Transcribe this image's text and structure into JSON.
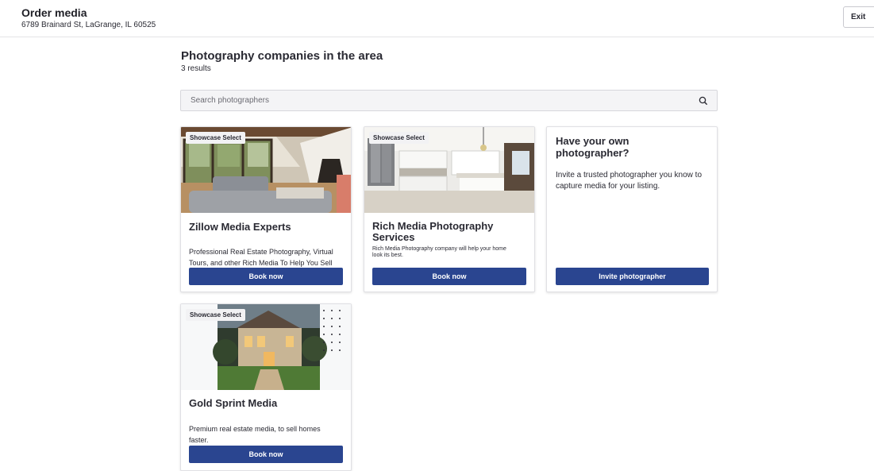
{
  "header": {
    "title": "Order media",
    "address": "6789 Brainard St, LaGrange, IL 60525",
    "exit_label": "Exit"
  },
  "main": {
    "title": "Photography companies in the area",
    "results": "3 results",
    "search_placeholder": "Search photographers"
  },
  "cards": [
    {
      "badge": "Showcase Select",
      "name": "Zillow Media Experts",
      "description": "Professional Real Estate Photography, Virtual Tours, and other Rich Media To Help You Sell",
      "button": "Book now"
    },
    {
      "badge": "Showcase Select",
      "name": "Rich Media Photography Services",
      "description": "Rich Media Photography company will help your home look its best.",
      "button": "Book now"
    },
    {
      "badge": "Showcase Select",
      "name": "Gold Sprint Media",
      "description": "Premium real estate media, to sell homes faster.",
      "button": "Book now"
    }
  ],
  "own_photographer": {
    "title": "Have your own photographer?",
    "description": "Invite a trusted photographer you know to capture media for your listing.",
    "button": "Invite photographer"
  },
  "colors": {
    "primary_button": "#2a4590",
    "text": "#2a2a33"
  },
  "icons": {
    "search": "search-icon"
  }
}
